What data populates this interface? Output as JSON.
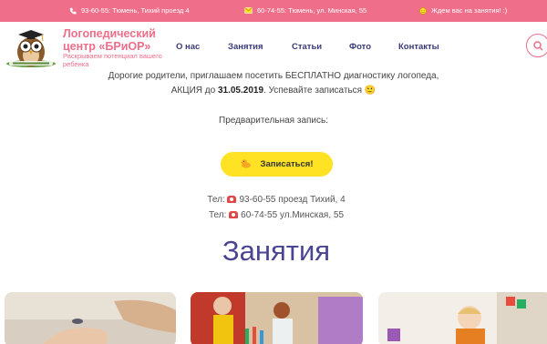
{
  "topbar": {
    "phone1": "93-60-55: Тюмень, Тихий проезд 4",
    "phone2": "60-74-55: Тюмень, ул. Минская, 55",
    "wait": "Ждем вас на занятия! :)"
  },
  "brand": {
    "title": "Логопедический центр «БРиОР»",
    "subtitle": "Раскрываем потенциал вашего ребенка"
  },
  "nav": [
    "О нас",
    "Занятия",
    "Статьи",
    "Фото",
    "Контакты"
  ],
  "promo": {
    "line1": "Дорогие родители, приглашаем  посетить БЕСПЛАТНО диагностику логопеда,",
    "line2_prefix": "АКЦИЯ до ",
    "line2_date": "31.05.2019",
    "line2_suffix": ". Успевайте записаться 🙂",
    "prelim": "Предварительная запись:"
  },
  "cta": {
    "label": "Записаться!"
  },
  "contacts": [
    {
      "prefix": "Тел:",
      "text": "93-60-55 проезд Тихий, 4"
    },
    {
      "prefix": "Тел:",
      "text": "60-74-55 ул.Минская, 55"
    }
  ],
  "section": {
    "title": "Занятия"
  },
  "colors": {
    "accent": "#ef6e8a",
    "nav": "#3a3a78",
    "cta": "#ffe224",
    "heading": "#4a4593"
  },
  "icons": [
    "phone-icon",
    "mail-icon",
    "smile-icon",
    "search-icon",
    "duck-icon",
    "telephone-emoji"
  ]
}
